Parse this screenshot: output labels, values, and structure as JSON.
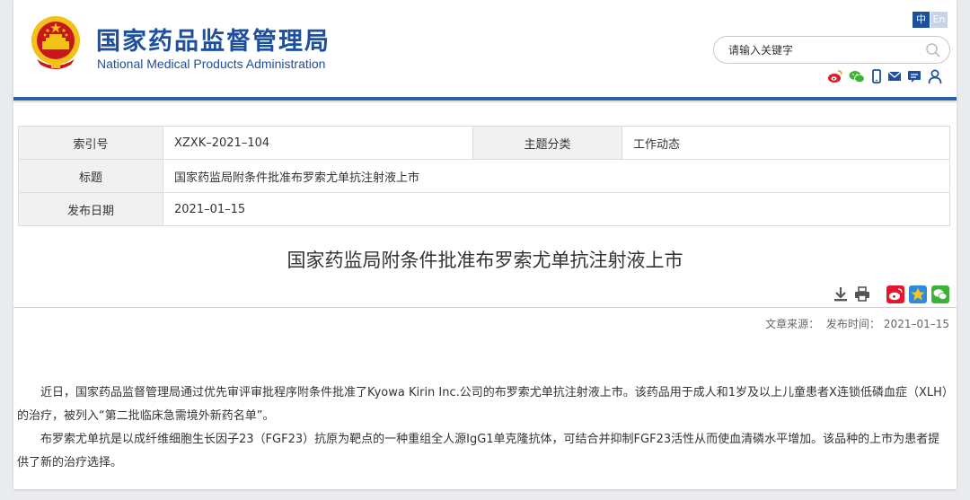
{
  "header": {
    "title_cn": "国家药品监督管理局",
    "title_en": "National Medical Products Administration",
    "lang_zh": "中",
    "lang_en": "En",
    "search_placeholder": "请输入关键字"
  },
  "meta": {
    "index_label": "索引号",
    "index_value": "XZXK–2021–104",
    "category_label": "主题分类",
    "category_value": "工作动态",
    "title_label": "标题",
    "title_value": "国家药监局附条件批准布罗索尤单抗注射液上市",
    "date_label": "发布日期",
    "date_value": "2021–01–15"
  },
  "article": {
    "title": "国家药监局附条件批准布罗索尤单抗注射液上市",
    "source_label": "文章来源：",
    "published_label": "发布时间：",
    "published_value": "2021–01–15",
    "paragraphs": [
      "近日，国家药品监督管理局通过优先审评审批程序附条件批准了Kyowa Kirin Inc.公司的布罗索尤单抗注射液上市。该药品用于成人和1岁及以上儿童患者X连锁低磷血症（XLH）的治疗，被列入“第二批临床急需境外新药名单”。",
      "布罗索尤单抗是以成纤维细胞生长因子23（FGF23）抗原为靶点的一种重组全人源IgG1单克隆抗体，可结合并抑制FGF23活性从而使血清磷水平增加。该品种的上市为患者提供了新的治疗选择。"
    ]
  },
  "icons": {
    "header_social": [
      "weibo-icon",
      "wechat-icon",
      "mobile-icon",
      "mail-icon",
      "message-icon",
      "user-icon"
    ],
    "tools": [
      "download-icon",
      "print-icon"
    ],
    "share": [
      "share-weibo-icon",
      "share-qzone-icon",
      "share-wechat-icon"
    ]
  },
  "colors": {
    "brand_blue": "#1d4f9c",
    "rule_blue": "#2d5fad",
    "emblem_red": "#c8161d",
    "emblem_gold": "#f3c118"
  }
}
